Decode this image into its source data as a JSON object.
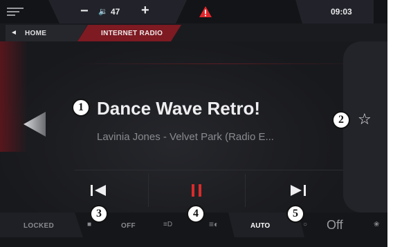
{
  "status_bar": {
    "menu_icon": "hamburger-icon",
    "volume_minus": "−",
    "volume_icon": "speaker-icon",
    "volume_value": "47",
    "volume_plus": "+",
    "warning_icon": "warning-triangle-icon",
    "clock": "09:03"
  },
  "breadcrumb": {
    "back_icon": "◄",
    "home_label": "HOME",
    "active_label": "INTERNET RADIO"
  },
  "now_playing": {
    "station": "Dance Wave Retro!",
    "track": "Lavinia Jones - Velvet Park (Radio E...",
    "favorite_icon": "☆"
  },
  "controls": {
    "previous_icon": "skip-previous-icon",
    "pause_icon": "pause-icon",
    "next_icon": "skip-next-icon",
    "accent_color": "#d92b2b"
  },
  "bottom_bar": {
    "locked_label": "LOCKED",
    "off_label": "OFF",
    "auto_label": "AUTO",
    "fan_off_label": "Off"
  },
  "badges": {
    "b1": "1",
    "b2": "2",
    "b3": "3",
    "b4": "4",
    "b5": "5"
  }
}
